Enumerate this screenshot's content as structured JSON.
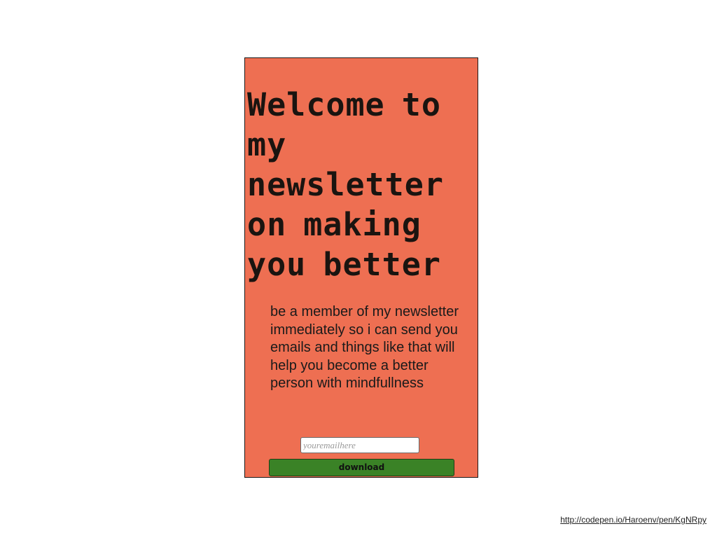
{
  "card": {
    "headline": "Welcome to my newsletter on making you better",
    "blurb": "be a member of my newsletter immediately so i can send you emails and things like that will help you become a better person with mindfullness",
    "email_placeholder": "youremailhere",
    "email_value": "",
    "download_label": "download"
  },
  "footer": {
    "source_link": "http://codepen.io/Haroenv/pen/KgNRpy"
  },
  "colors": {
    "card_background": "#ee6f52",
    "button_background": "#3a8226",
    "page_background": "#ffffff"
  }
}
